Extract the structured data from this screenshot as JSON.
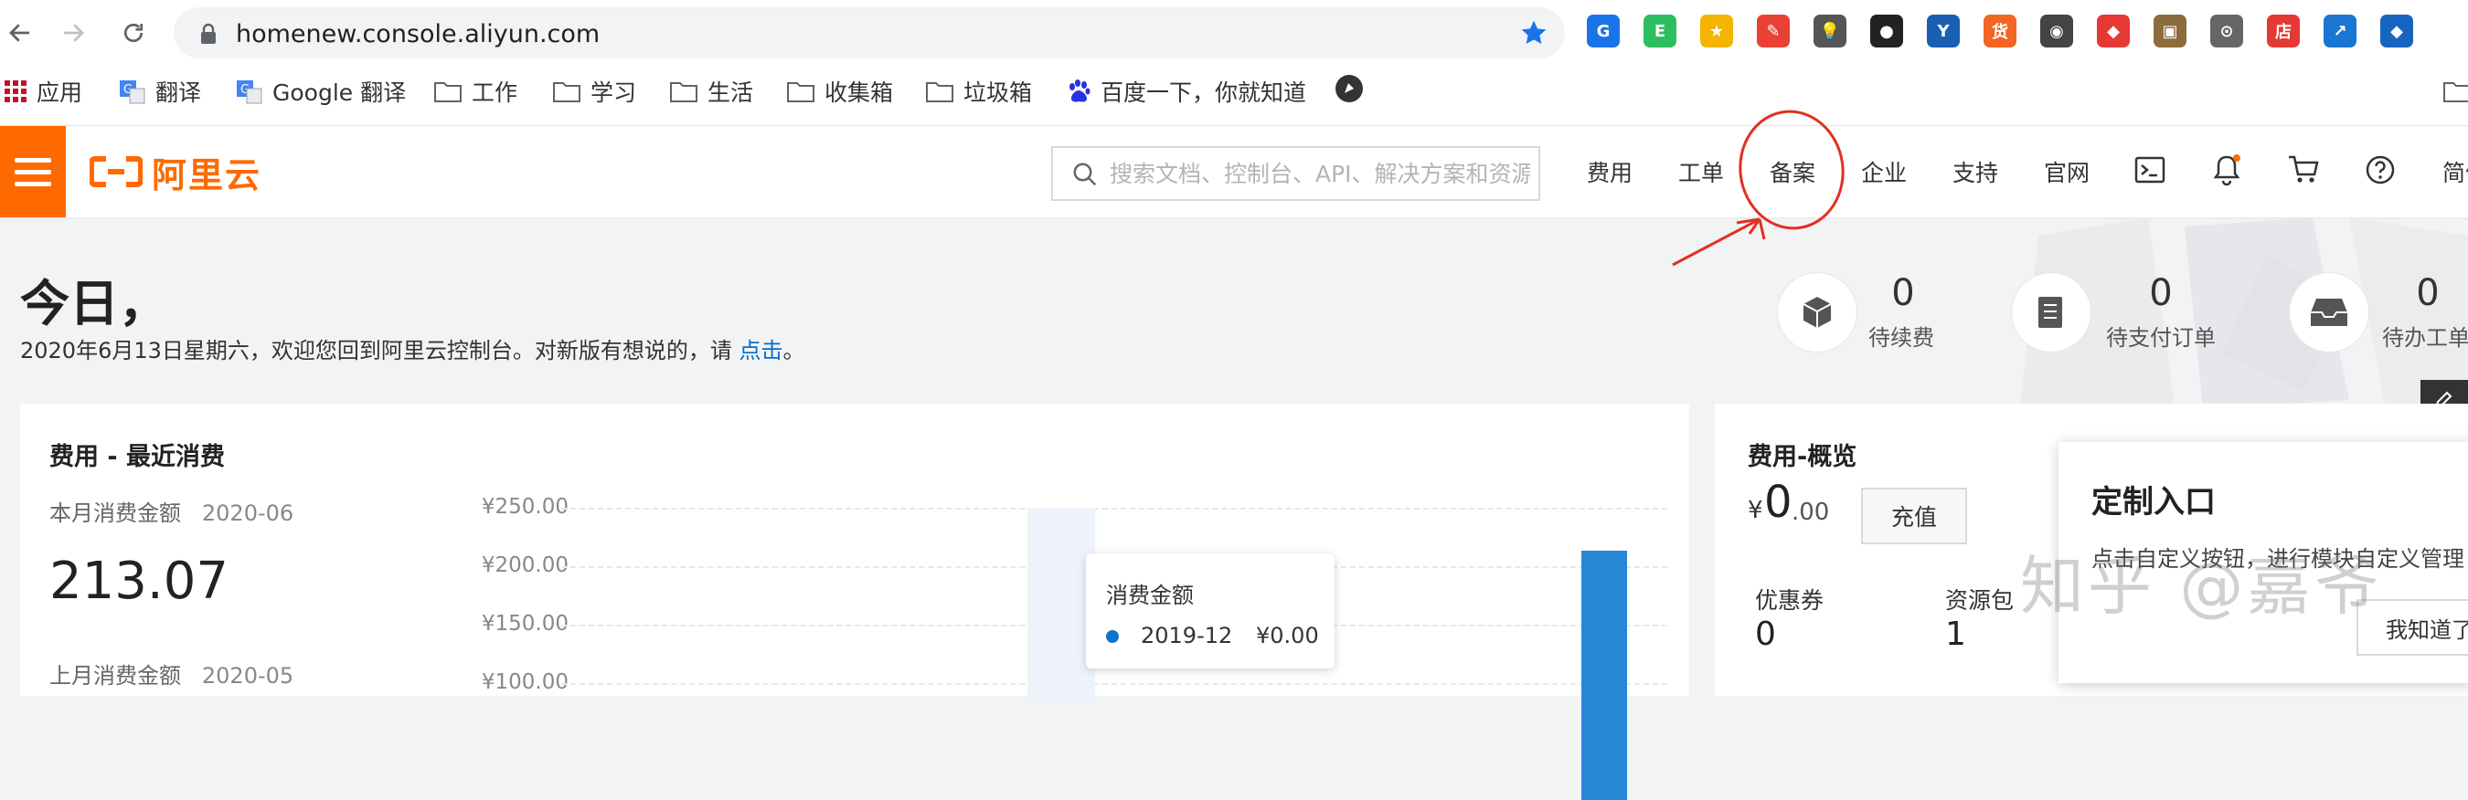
{
  "browser": {
    "url": "homenew.console.aliyun.com",
    "extensions": [
      {
        "name": "ext-blue-circle-icon",
        "color": "#1a73e8",
        "glyph": "G"
      },
      {
        "name": "evernote-icon",
        "color": "#2dbe60",
        "glyph": "E"
      },
      {
        "name": "ext-yellow-icon",
        "color": "#f4b400",
        "glyph": "★"
      },
      {
        "name": "ext-multicolor-icon",
        "color": "#e94235",
        "glyph": "✎"
      },
      {
        "name": "lightbulb-icon",
        "color": "#555555",
        "glyph": "💡"
      },
      {
        "name": "ext-bear-icon",
        "color": "#222222",
        "glyph": "●"
      },
      {
        "name": "ext-v-icon",
        "color": "#1a5fb4",
        "glyph": "Y"
      },
      {
        "name": "ext-orange-cn-icon",
        "color": "#f26522",
        "glyph": "货"
      },
      {
        "name": "ext-camera-icon",
        "color": "#444444",
        "glyph": "◉"
      },
      {
        "name": "ext-red-shape-icon",
        "color": "#e53935",
        "glyph": "◆"
      },
      {
        "name": "ext-picture-icon",
        "color": "#8a6d3b",
        "glyph": "▣"
      },
      {
        "name": "ext-gray-circle-icon",
        "color": "#666666",
        "glyph": "⊙"
      },
      {
        "name": "ext-shop-icon",
        "color": "#e53935",
        "glyph": "店"
      },
      {
        "name": "ext-chart-icon",
        "color": "#1976d2",
        "glyph": "↗"
      },
      {
        "name": "ext-cube-icon",
        "color": "#1565c0",
        "glyph": "◆"
      }
    ]
  },
  "bookmarks": [
    {
      "label": "应用",
      "icon": "apps-grid-icon"
    },
    {
      "label": "翻译",
      "icon": "translate-icon"
    },
    {
      "label": "Google 翻译",
      "icon": "translate-icon"
    },
    {
      "label": "工作",
      "icon": "folder-icon"
    },
    {
      "label": "学习",
      "icon": "folder-icon"
    },
    {
      "label": "生活",
      "icon": "folder-icon"
    },
    {
      "label": "收集箱",
      "icon": "folder-icon"
    },
    {
      "label": "垃圾箱",
      "icon": "folder-icon"
    },
    {
      "label": "百度一下，你就知道",
      "icon": "baidu-paw-icon"
    }
  ],
  "header": {
    "logo_text": "阿里云",
    "search_placeholder": "搜索文档、控制台、API、解决方案和资源",
    "nav": [
      "费用",
      "工单",
      "备案",
      "企业",
      "支持",
      "官网"
    ],
    "lang_label": "简体",
    "brand_color": "#ff6a00"
  },
  "welcome": {
    "title": "今日，",
    "subtitle": "2020年6月13日星期六，欢迎您回到阿里云控制台。对新版有想说的，请 ",
    "link": "点击",
    "suffix": "。"
  },
  "stats": [
    {
      "value": "0",
      "label": "待续费",
      "icon": "box-icon"
    },
    {
      "value": "0",
      "label": "待支付订单",
      "icon": "document-icon"
    },
    {
      "value": "0",
      "label": "待办工单",
      "icon": "inbox-icon"
    }
  ],
  "cost_card": {
    "title": "费用 - 最近消费",
    "this_month_label": "本月消费金额",
    "this_month_period": "2020-06",
    "this_month_amount": "213.07",
    "last_month_label": "上月消费金额",
    "last_month_period": "2020-05",
    "y_ticks": [
      "¥250.00",
      "¥200.00",
      "¥150.00",
      "¥100.00"
    ],
    "tooltip": {
      "title": "消费金额",
      "period": "2019-12",
      "value": "¥0.00"
    },
    "bar_color": "#2787d7"
  },
  "chart_data": {
    "type": "bar",
    "categories": [
      "2019-12",
      "2020-06"
    ],
    "values": [
      0,
      213.07
    ],
    "ylim": [
      0,
      250
    ]
  },
  "overview_card": {
    "title": "费用-概览",
    "currency": "¥",
    "amount": "0",
    "cents": ".00",
    "recharge_label": "充值",
    "coupon_label": "优惠券",
    "coupon_value": "0",
    "package_label": "资源包",
    "package_value": "1"
  },
  "popup": {
    "title": "定制入口",
    "body": "点击自定义按钮，进行模块自定义管理",
    "button_label": "我知道了"
  },
  "watermark": "知乎 @嘉爷"
}
